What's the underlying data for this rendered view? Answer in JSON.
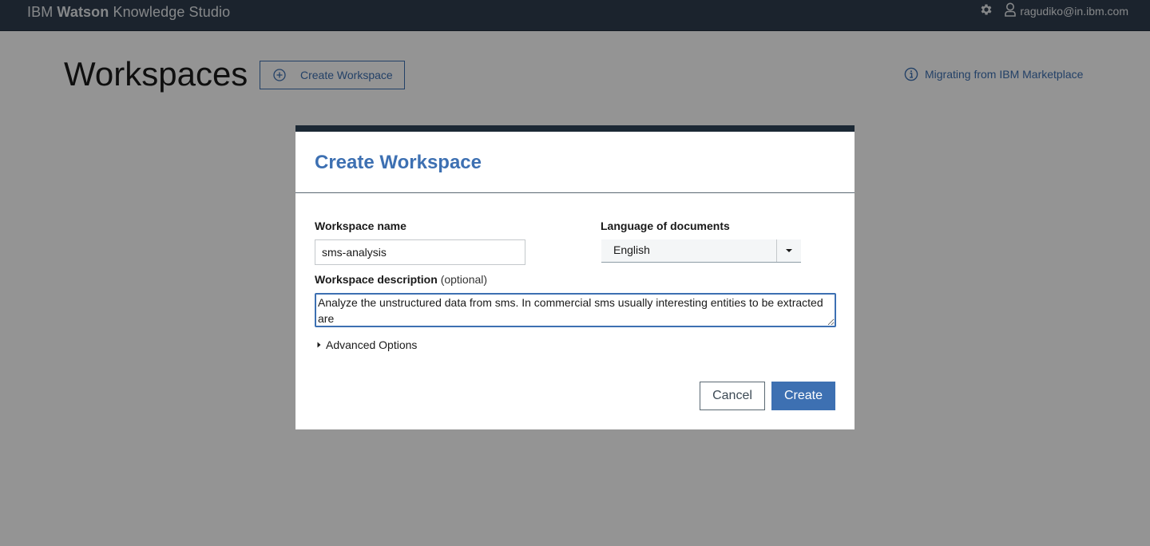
{
  "topbar": {
    "brand_prefix": "IBM",
    "brand_bold": "Watson",
    "brand_suffix": "Knowledge Studio",
    "user_email": "ragudiko@in.ibm.com",
    "settings_icon": "gear-icon",
    "user_icon": "user-icon"
  },
  "page": {
    "title": "Workspaces",
    "create_button_label": "Create Workspace",
    "migrate_link_label": "Migrating from IBM Marketplace"
  },
  "modal": {
    "title": "Create Workspace",
    "name_label": "Workspace name",
    "name_value": "sms-analysis",
    "language_label": "Language of documents",
    "language_value": "English",
    "description_label": "Workspace description",
    "description_optional": "(optional)",
    "description_value": "Analyze the unstructured data from sms. In commercial sms usually interesting entities to be extracted are",
    "advanced_label": "Advanced Options",
    "cancel_label": "Cancel",
    "create_label": "Create"
  },
  "colors": {
    "topbar_bg": "#2f3d4e",
    "accent": "#3d70b2",
    "modal_top_border": "#1b2834"
  }
}
